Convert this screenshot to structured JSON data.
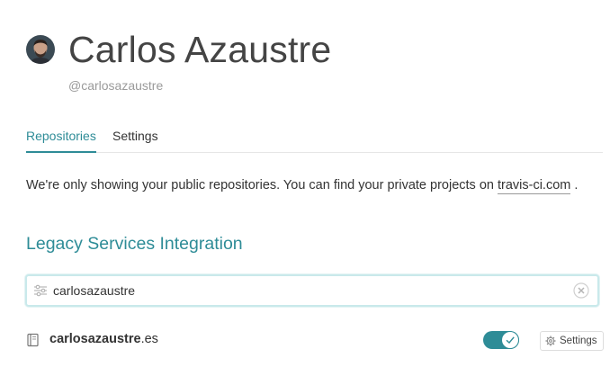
{
  "profile": {
    "name": "Carlos Azaustre",
    "handle": "@carlosazaustre"
  },
  "tabs": [
    {
      "label": "Repositories",
      "active": true
    },
    {
      "label": "Settings",
      "active": false
    }
  ],
  "notice": {
    "text_before": "We're only showing your public repositories. You can find your private projects on ",
    "link_label": "travis-ci.com",
    "text_after": " ."
  },
  "section": {
    "title": "Legacy Services Integration"
  },
  "filter": {
    "value": "carlosazaustre",
    "icon": "filter-sliders-icon",
    "clear_icon": "clear-icon"
  },
  "repositories": [
    {
      "owner": "carlosazaustre",
      "repo": ".es",
      "icon": "repo-book-icon",
      "enabled": true,
      "settings_label": "Settings"
    }
  ],
  "colors": {
    "accent": "#2e8c97",
    "text": "#333333",
    "muted": "#9a9a9a",
    "filter_border": "#c9e9eb"
  }
}
